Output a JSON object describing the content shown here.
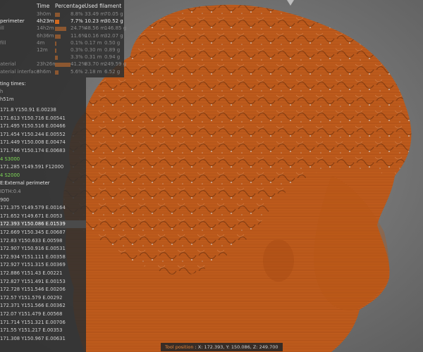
{
  "legend": {
    "headers": {
      "time": "Time",
      "percentage": "Percentage",
      "used_filament": "Used filament"
    },
    "rows": [
      {
        "name": "",
        "time": "3h0m",
        "percentage": "8.8%",
        "length": "33.49 m",
        "weight": "70.05 g",
        "pct": 8.8,
        "state": "muted"
      },
      {
        "name": "perimeter",
        "time": "4h23m",
        "percentage": "7.7%",
        "length": "10.23 m",
        "weight": "30.52 g",
        "pct": 7.7,
        "state": "selected"
      },
      {
        "name": "ill",
        "time": "14h2m",
        "percentage": "24.7%",
        "length": "48.56 m",
        "weight": "146.85 g",
        "pct": 24.7,
        "state": "muted"
      },
      {
        "name": "",
        "time": "6h36m",
        "percentage": "11.6%",
        "length": "10.16 m",
        "weight": "32.07 g",
        "pct": 11.6,
        "state": "muted"
      },
      {
        "name": "fill",
        "time": "4m",
        "percentage": "0.1%",
        "length": "0.17 m",
        "weight": "0.50 g",
        "pct": 0.1,
        "state": "muted"
      },
      {
        "name": "",
        "time": "12m",
        "percentage": "0.3%",
        "length": "0.30 m",
        "weight": "0.89 g",
        "pct": 0.3,
        "state": "muted"
      },
      {
        "name": "",
        "time": "",
        "percentage": "3.3%",
        "length": "0.31 m",
        "weight": "0.94 g",
        "pct": 3.3,
        "state": "muted"
      },
      {
        "name": "aterial",
        "time": "23h26m",
        "percentage": "41.2%",
        "length": "83.70 m",
        "weight": "249.59 g",
        "pct": 41.2,
        "state": "muted"
      },
      {
        "name": "aterial interface",
        "time": "3h6m",
        "percentage": "5.6%",
        "length": "2.18 m",
        "weight": "6.52 g",
        "pct": 5.6,
        "state": "muted"
      }
    ],
    "printing_times_label": "ting times:",
    "printing_time_1": "h",
    "printing_time_2": "h51m"
  },
  "gcode_lines": [
    {
      "text": "171.8 Y150.91 E.00238",
      "style": ""
    },
    {
      "text": "171.613 Y150.716 E.00541",
      "style": ""
    },
    {
      "text": "171.495 Y150.516 E.00466",
      "style": ""
    },
    {
      "text": "171.454 Y150.244 E.00552",
      "style": ""
    },
    {
      "text": "171.449 Y150.008 E.00474",
      "style": ""
    },
    {
      "text": "171.746 Y150.174 E.00683",
      "style": ""
    },
    {
      "text": "4 S3000",
      "style": "green"
    },
    {
      "text": "171.285 Y149.591 F12000",
      "style": ""
    },
    {
      "text": "4 S2000",
      "style": "green"
    },
    {
      "text": "E:External perimeter",
      "style": "hdr"
    },
    {
      "text": "IDTH:0.4",
      "style": "dimt"
    },
    {
      "text": "900",
      "style": ""
    },
    {
      "text": "171.375 Y149.579 E.00164",
      "style": ""
    },
    {
      "text": "171.652 Y149.671 E.0053",
      "style": ""
    },
    {
      "text": "172.393 Y150.086 E.01539",
      "style": "current"
    },
    {
      "text": "172.669 Y150.345 E.00687",
      "style": ""
    },
    {
      "text": "172.83 Y150.633 E.00598",
      "style": ""
    },
    {
      "text": "172.907 Y150.916 E.00531",
      "style": ""
    },
    {
      "text": "172.934 Y151.111 E.00358",
      "style": ""
    },
    {
      "text": "172.927 Y151.315 E.00369",
      "style": ""
    },
    {
      "text": "172.886 Y151.43 E.00221",
      "style": ""
    },
    {
      "text": "172.827 Y151.491 E.00153",
      "style": ""
    },
    {
      "text": "172.728 Y151.546 E.00206",
      "style": ""
    },
    {
      "text": "172.57 Y151.579 E.00292",
      "style": ""
    },
    {
      "text": "172.371 Y151.566 E.00362",
      "style": ""
    },
    {
      "text": "172.07 Y151.479 E.00568",
      "style": ""
    },
    {
      "text": "171.714 Y151.321 E.00706",
      "style": ""
    },
    {
      "text": "171.55 Y151.217 E.00353",
      "style": ""
    },
    {
      "text": "171.308 Y150.967 E.00631",
      "style": ""
    }
  ],
  "toolpos": {
    "label": "Tool position",
    "x": "X: 172.393,",
    "y": "Y: 150.086,",
    "z": "Z: 249.700"
  },
  "colors": {
    "model": "#c8621f",
    "accent": "#d2691e",
    "gcode_tool": "#7ed957"
  },
  "icons": {
    "tool_marker": "tool-marker-icon"
  }
}
